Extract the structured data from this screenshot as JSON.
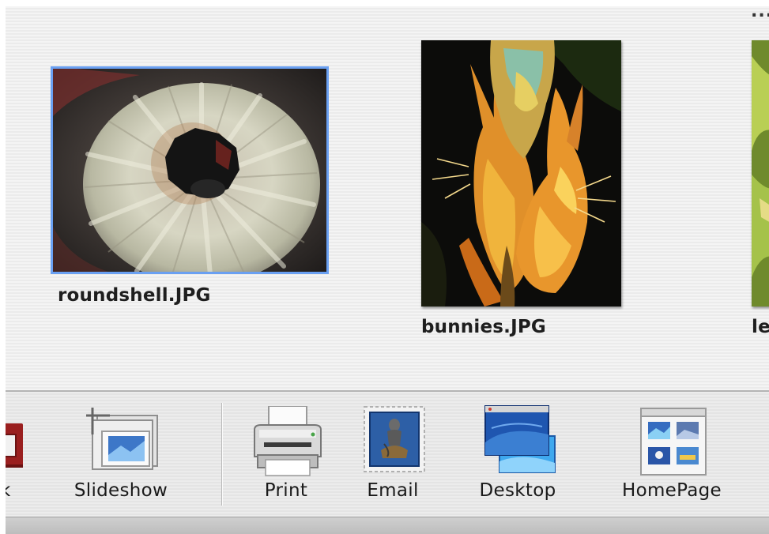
{
  "browser": {
    "overflow_indicator": "...",
    "photos": [
      {
        "filename": "roundshell.JPG",
        "selected": true
      },
      {
        "filename": "bunnies.JPG",
        "selected": false
      },
      {
        "filename": "le",
        "selected": false
      }
    ]
  },
  "toolbar": {
    "buttons": [
      {
        "label": "k",
        "icon": "book-icon"
      },
      {
        "label": "Slideshow",
        "icon": "slideshow-icon"
      },
      {
        "label": "Print",
        "icon": "printer-icon"
      },
      {
        "label": "Email",
        "icon": "email-stamp-icon"
      },
      {
        "label": "Desktop",
        "icon": "desktop-picture-icon"
      },
      {
        "label": "HomePage",
        "icon": "homepage-icon"
      }
    ]
  },
  "colors": {
    "selection_outline": "#6aa0f2",
    "browser_background": "#f1f1f1",
    "toolbar_background": "#e9e9e9"
  }
}
